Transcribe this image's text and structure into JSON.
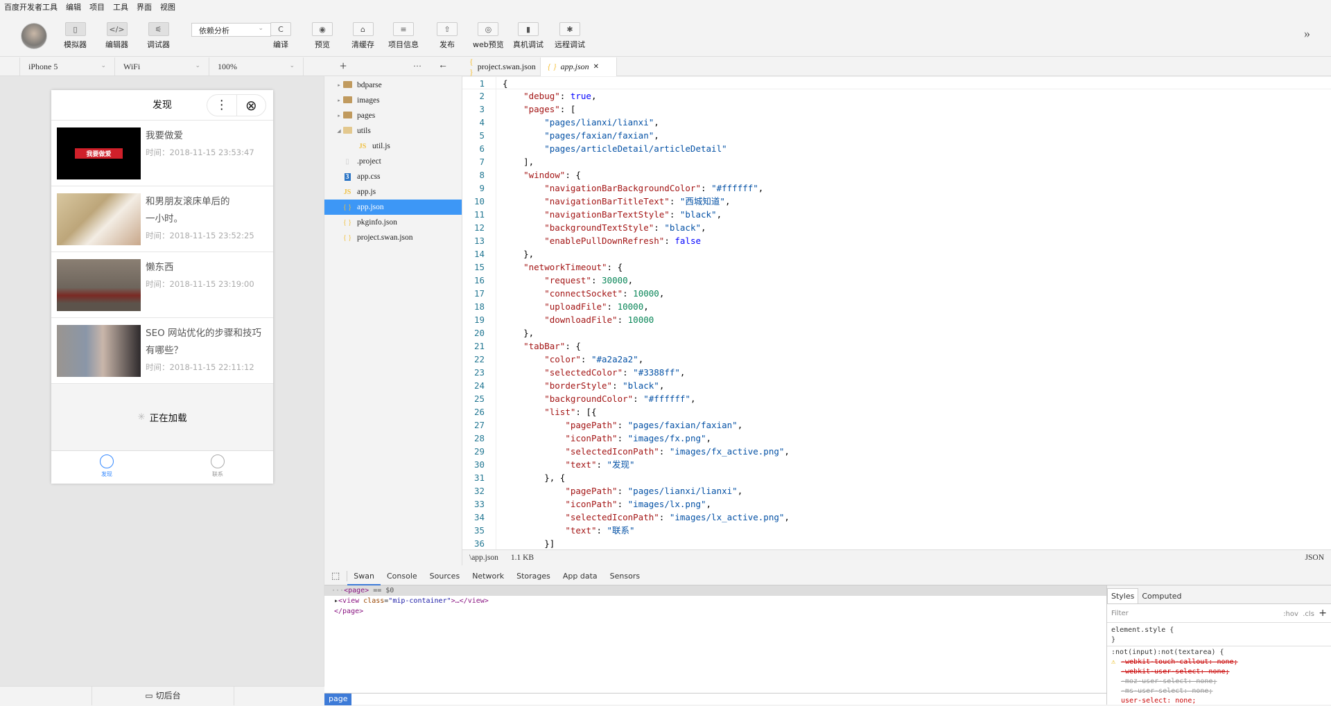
{
  "menu": [
    "百度开发者工具",
    "编辑",
    "项目",
    "工具",
    "界面",
    "视图"
  ],
  "toolbar": {
    "simulator": "模拟器",
    "editor": "编辑器",
    "debugger": "调试器",
    "dependency": "依赖分析",
    "compile": "编译",
    "preview": "预览",
    "clear_cache": "清缓存",
    "project_info": "项目信息",
    "publish": "发布",
    "web_preview": "web预览",
    "device_debug": "真机调试",
    "remote_debug": "远程调试",
    "more": "»"
  },
  "subbar": {
    "device": "iPhone 5",
    "network": "WiFi",
    "zoom": "100%",
    "add": "+",
    "more": "···",
    "back": "←"
  },
  "phone": {
    "title": "发现",
    "menu": "⋮",
    "close": "⊗",
    "articles": [
      {
        "title": "我要做爱",
        "time": "时间：2018-11-15 23:53:47",
        "thumb_text": "我要做爱"
      },
      {
        "title": "和男朋友滚床单后的一小时。",
        "time": "时间：2018-11-15 23:52:25"
      },
      {
        "title": "懒东西",
        "time": "时间：2018-11-15 23:19:00"
      },
      {
        "title": "SEO 网站优化的步骤和技巧有哪些？",
        "time": "时间：2018-11-15 22:11:12"
      }
    ],
    "loading": "正在加载",
    "tabs": [
      {
        "label": "发现",
        "active": true
      },
      {
        "label": "联系",
        "active": false
      }
    ],
    "selected_color": "#3388ff"
  },
  "switch_bg": "切后台",
  "files": [
    {
      "name": "bdparse",
      "type": "folder",
      "arrow": "▸"
    },
    {
      "name": "images",
      "type": "folder",
      "arrow": "▸"
    },
    {
      "name": "pages",
      "type": "folder",
      "arrow": "▸"
    },
    {
      "name": "utils",
      "type": "folder-open",
      "arrow": "◢"
    },
    {
      "name": "util.js",
      "type": "js",
      "indent": true
    },
    {
      "name": ".project",
      "type": "file"
    },
    {
      "name": "app.css",
      "type": "css"
    },
    {
      "name": "app.js",
      "type": "js"
    },
    {
      "name": "app.json",
      "type": "json",
      "selected": true
    },
    {
      "name": "pkginfo.json",
      "type": "json"
    },
    {
      "name": "project.swan.json",
      "type": "json"
    }
  ],
  "editor_tabs": [
    {
      "label": "project.swan.json",
      "active": false
    },
    {
      "label": "app.json",
      "active": true
    }
  ],
  "code": [
    "{",
    "    \"debug\": true,",
    "    \"pages\": [",
    "        \"pages/lianxi/lianxi\",",
    "        \"pages/faxian/faxian\",",
    "        \"pages/articleDetail/articleDetail\"",
    "    ],",
    "    \"window\": {",
    "        \"navigationBarBackgroundColor\": \"#ffffff\",",
    "        \"navigationBarTitleText\": \"西城知道\",",
    "        \"navigationBarTextStyle\": \"black\",",
    "        \"backgroundTextStyle\": \"black\",",
    "        \"enablePullDownRefresh\": false",
    "    },",
    "    \"networkTimeout\": {",
    "        \"request\": 30000,",
    "        \"connectSocket\": 10000,",
    "        \"uploadFile\": 10000,",
    "        \"downloadFile\": 10000",
    "    },",
    "    \"tabBar\": {",
    "        \"color\": \"#a2a2a2\",",
    "        \"selectedColor\": \"#3388ff\",",
    "        \"borderStyle\": \"black\",",
    "        \"backgroundColor\": \"#ffffff\",",
    "        \"list\": [{",
    "            \"pagePath\": \"pages/faxian/faxian\",",
    "            \"iconPath\": \"images/fx.png\",",
    "            \"selectedIconPath\": \"images/fx_active.png\",",
    "            \"text\": \"发现\"",
    "        }, {",
    "            \"pagePath\": \"pages/lianxi/lianxi\",",
    "            \"iconPath\": \"images/lx.png\",",
    "            \"selectedIconPath\": \"images/lx_active.png\",",
    "            \"text\": \"联系\"",
    "        }]"
  ],
  "status": {
    "path": "\\app.json",
    "size": "1.1 KB",
    "lang": "JSON"
  },
  "devtools": {
    "tabs": [
      "Swan",
      "Console",
      "Sources",
      "Network",
      "Storages",
      "App data",
      "Sensors"
    ],
    "active_tab": "Swan",
    "dom": {
      "l1_tag": "<page>",
      "l1_suffix": " == $0",
      "l2_open": "<view ",
      "l2_attr": "class",
      "l2_val": "\"mip-container\"",
      "l2_close": ">…</view>",
      "l3": "</page>"
    },
    "breadcrumb": "page",
    "styles": {
      "tabs": [
        "Styles",
        "Computed"
      ],
      "filter": "Filter",
      "hov": ":hov",
      "cls": ".cls",
      "add": "+",
      "lines": [
        "element.style {",
        "}",
        ":not(input):not(textarea) {"
      ],
      "props": [
        "-webkit-touch-callout: none;",
        "-webkit-user-select: none;",
        "-moz-user-select: none;",
        "-ms-user-select: none;",
        "user-select: none;"
      ]
    }
  }
}
